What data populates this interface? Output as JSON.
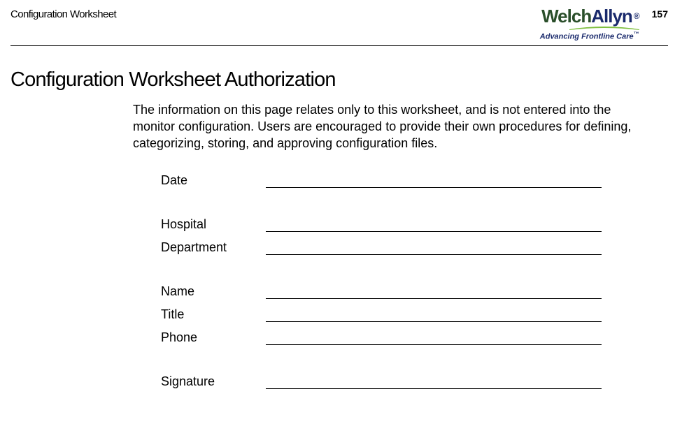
{
  "header": {
    "running_title": "Configuration Worksheet",
    "page_number": "157",
    "brand": {
      "welch": "Welch",
      "allyn": "Allyn",
      "reg": "®",
      "tagline": "Advancing Frontline Care",
      "tm": "™"
    }
  },
  "section_heading": "Configuration Worksheet Authorization",
  "intro_text": "The information on this page relates only to this worksheet, and is not entered into the monitor configuration. Users are encouraged to provide their own procedures for defining, categorizing, storing, and approving configuration files.",
  "fields": {
    "date": "Date",
    "hospital": "Hospital",
    "department": "Department",
    "name": "Name",
    "title": "Title",
    "phone": "Phone",
    "signature": "Signature"
  }
}
